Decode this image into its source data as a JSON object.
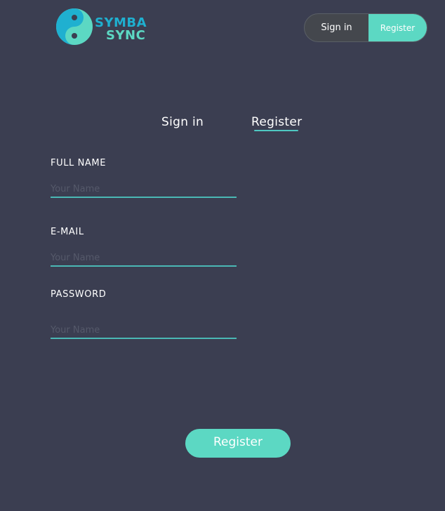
{
  "brand": {
    "line1": "SYMBA",
    "line2": "SYNC",
    "logo_icon": "s-swirl-logo-icon",
    "colors": {
      "primary": "#1fb0d0",
      "secondary": "#5cd8c3"
    }
  },
  "header": {
    "signin_label": "Sign in",
    "register_label": "Register"
  },
  "tabs": [
    {
      "label": "Sign in",
      "active": false
    },
    {
      "label": "Register",
      "active": true
    }
  ],
  "form": {
    "fields": [
      {
        "label": "FULL NAME",
        "placeholder": "Your Name",
        "value": ""
      },
      {
        "label": "E-MAIL",
        "placeholder": "Your Name",
        "value": ""
      },
      {
        "label": "PASSWORD",
        "placeholder": "Your Name",
        "value": ""
      }
    ],
    "submit_label": "Register"
  },
  "colors": {
    "background": "#3b3e51",
    "accent": "#5cd8c3",
    "underline": "#4ab8b5",
    "text": "#ffffff"
  }
}
